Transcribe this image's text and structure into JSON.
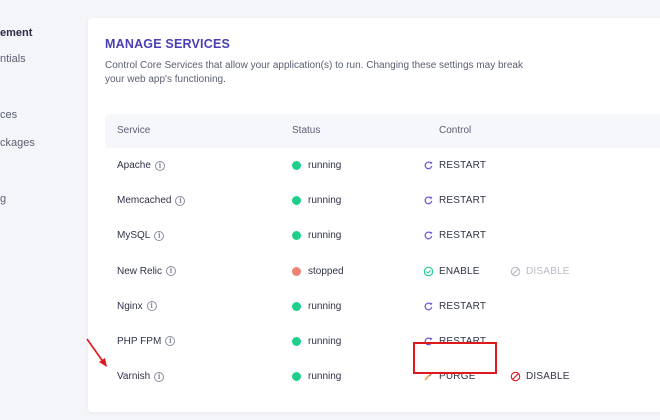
{
  "sidebar": {
    "items": [
      {
        "label": "ement",
        "active": true
      },
      {
        "label": "ntials",
        "active": false
      },
      {
        "label": "ces",
        "active": false
      },
      {
        "label": "ckages",
        "active": false
      },
      {
        "label": "g",
        "active": false
      }
    ]
  },
  "section": {
    "title": "MANAGE SERVICES",
    "description": "Control Core Services that allow your application(s) to run. Changing these settings may break your web app's functioning."
  },
  "table": {
    "headers": {
      "service": "Service",
      "status": "Status",
      "control": "Control"
    },
    "info_glyph": "i",
    "rows": [
      {
        "service": "Apache",
        "status": "running",
        "control": "RESTART",
        "control_icon": "restart-icon"
      },
      {
        "service": "Memcached",
        "status": "running",
        "control": "RESTART",
        "control_icon": "restart-icon"
      },
      {
        "service": "MySQL",
        "status": "running",
        "control": "RESTART",
        "control_icon": "restart-icon"
      },
      {
        "service": "New Relic",
        "status": "stopped",
        "control": "ENABLE",
        "control_icon": "check-circle-icon",
        "control2": "DISABLE",
        "control2_disabled": true
      },
      {
        "service": "Nginx",
        "status": "running",
        "control": "RESTART",
        "control_icon": "restart-icon"
      },
      {
        "service": "PHP FPM",
        "status": "running",
        "control": "RESTART",
        "control_icon": "restart-icon"
      },
      {
        "service": "Varnish",
        "status": "running",
        "control": "PURGE",
        "control_icon": "broom-icon",
        "control2": "DISABLE",
        "control2_disabled": false
      }
    ]
  },
  "colors": {
    "accent": "#4a3fb5",
    "running": "#1ecf8b",
    "stopped": "#f08070",
    "restart_icon": "#6c5fd6",
    "enable_icon": "#1ecf8b",
    "disable_active": "#e0171c",
    "highlight": "#e0171c"
  }
}
